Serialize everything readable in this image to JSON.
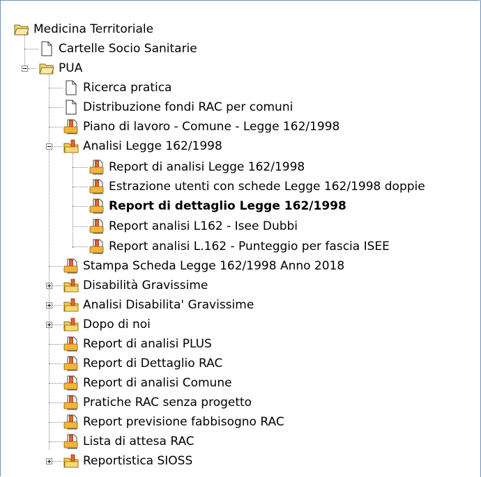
{
  "tree": {
    "root": {
      "label": "Medicina Territoriale",
      "icon": "open-folder-icon"
    },
    "items": [
      {
        "label": "Cartelle Socio Sanitarie",
        "icon": "document-icon"
      },
      {
        "label": "PUA",
        "icon": "open-folder-icon"
      },
      {
        "label": "Ricerca pratica",
        "icon": "document-icon"
      },
      {
        "label": "Distribuzione fondi RAC per comuni",
        "icon": "document-icon"
      },
      {
        "label": "Piano di lavoro - Comune - Legge 162/1998",
        "icon": "report-icon"
      },
      {
        "label": "Analisi Legge 162/1998",
        "icon": "report-folder-icon"
      },
      {
        "label": "Report di analisi Legge 162/1998",
        "icon": "report-icon"
      },
      {
        "label": "Estrazione utenti con schede Legge 162/1998 doppie",
        "icon": "report-icon"
      },
      {
        "label": "Report di dettaglio Legge 162/1998",
        "icon": "report-icon",
        "selected": true
      },
      {
        "label": "Report analisi L162 - Isee Dubbi",
        "icon": "report-icon"
      },
      {
        "label": "Report analisi L.162 - Punteggio per fascia ISEE",
        "icon": "report-icon"
      },
      {
        "label": "Stampa Scheda Legge 162/1998 Anno 2018",
        "icon": "report-icon"
      },
      {
        "label": "Disabilità Gravissime",
        "icon": "report-folder-icon"
      },
      {
        "label": "Analisi Disabilita' Gravissime",
        "icon": "report-folder-icon"
      },
      {
        "label": "Dopo di noi",
        "icon": "report-folder-icon"
      },
      {
        "label": "Report di analisi PLUS",
        "icon": "report-icon"
      },
      {
        "label": "Report di Dettaglio RAC",
        "icon": "report-icon"
      },
      {
        "label": "Report di analisi Comune",
        "icon": "report-icon"
      },
      {
        "label": "Pratiche RAC senza progetto",
        "icon": "report-icon"
      },
      {
        "label": "Report previsione fabbisogno RAC",
        "icon": "report-icon"
      },
      {
        "label": "Lista di attesa RAC",
        "icon": "report-icon"
      },
      {
        "label": "Reportistica SIOSS",
        "icon": "report-folder-icon"
      }
    ]
  }
}
